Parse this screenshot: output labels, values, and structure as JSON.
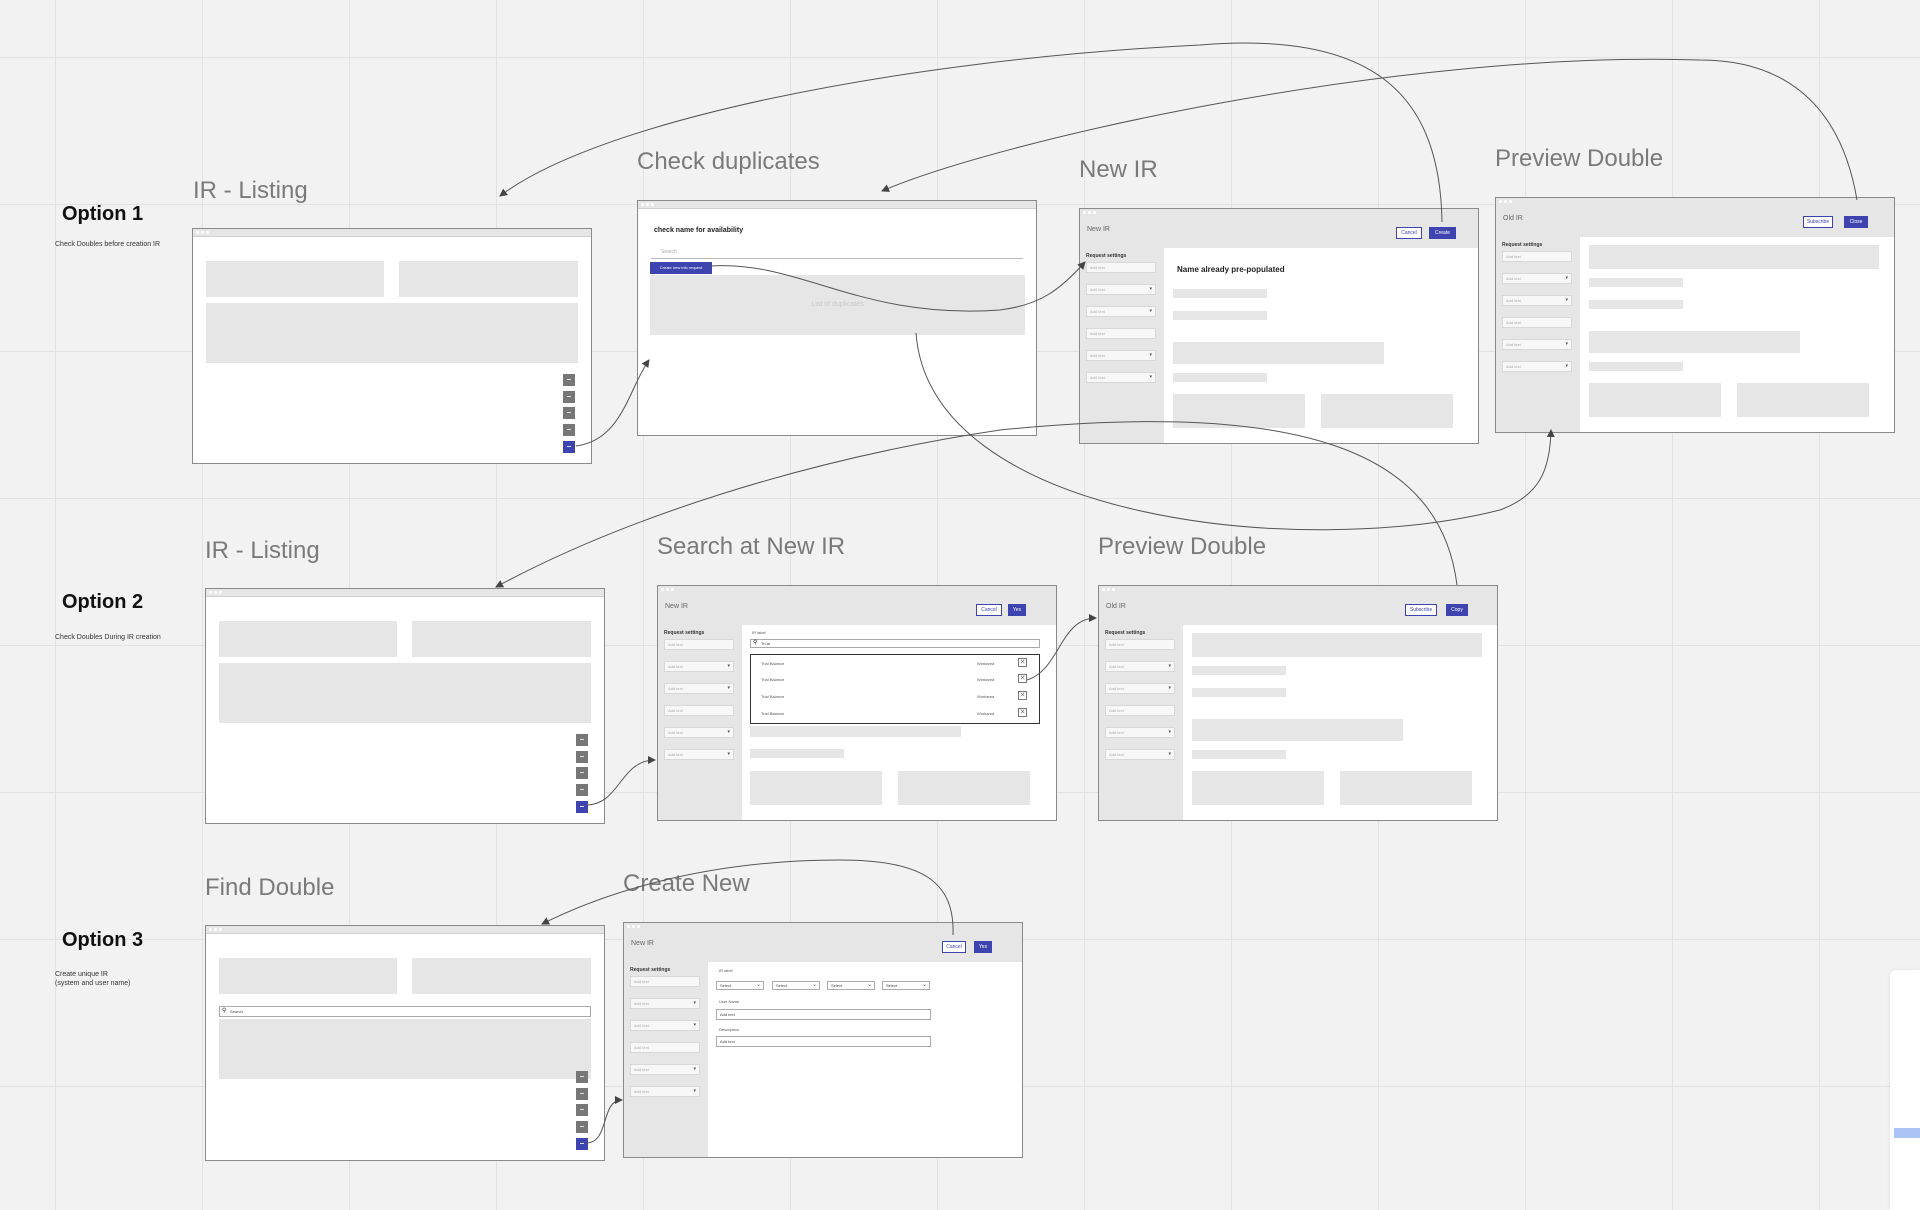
{
  "options": [
    {
      "title": "Option 1",
      "description": "Check Doubles before creation IR"
    },
    {
      "title": "Option 2",
      "description": "Check Doubles During IR creation"
    },
    {
      "title": "Option 3",
      "description": "Create unique IR\n(system and user name)"
    }
  ],
  "frames": {
    "ir_listing_1": {
      "title": "IR - Listing"
    },
    "check_duplicates": {
      "title": "Check duplicates",
      "heading": "check name for availability",
      "search_placeholder": "Search",
      "button_label": "Create new info request",
      "list_label": "List of duplicates"
    },
    "new_ir": {
      "title": "New IR",
      "app_title": "New IR",
      "cancel_label": "Cancel",
      "create_label": "Create",
      "sidebar_label": "Request settings",
      "message": "Name already pre-populated"
    },
    "preview_double_1": {
      "title": "Preview Double",
      "app_title": "Old IR",
      "subscribe_label": "Subscribe",
      "close_label": "Close",
      "sidebar_label": "Request settings"
    },
    "ir_listing_2": {
      "title": "IR - Listing"
    },
    "search_new_ir": {
      "title": "Search at  New IR",
      "app_title": "New IR",
      "cancel_label": "Cancel",
      "yes_label": "Yes",
      "sidebar_label": "Request settings",
      "field_label": "IR label",
      "search_value": "Tri-al",
      "results": [
        {
          "name": "Trial Balance",
          "owner": "Workarea"
        },
        {
          "name": "Trial Balance",
          "owner": "Workarea"
        },
        {
          "name": "Trial Balance",
          "owner": "Workarea"
        },
        {
          "name": "Trial Balance",
          "owner": "Workarea"
        }
      ]
    },
    "preview_double_2": {
      "title": "Preview Double",
      "app_title": "Old IR",
      "subscribe_label": "Subscribe",
      "copy_label": "Copy",
      "sidebar_label": "Request settings"
    },
    "find_double": {
      "title": "Find Double",
      "search_value": "Search"
    },
    "create_new": {
      "title": "Create New",
      "app_title": "New IR",
      "cancel_label": "Cancel",
      "yes_label": "Yes",
      "sidebar_label": "Request settings",
      "field_label": "IR label",
      "selects": [
        "Select",
        "Select",
        "Select",
        "Select"
      ],
      "user_name_label": "User Name",
      "user_name_value": "Add text",
      "description_label": "Description",
      "description_value": "Add text"
    }
  },
  "placeholder_field_text": "Add text",
  "colors": {
    "accent": "#3d44b0",
    "placeholder": "#e6e6e6",
    "canvas": "#f2f2f2"
  }
}
